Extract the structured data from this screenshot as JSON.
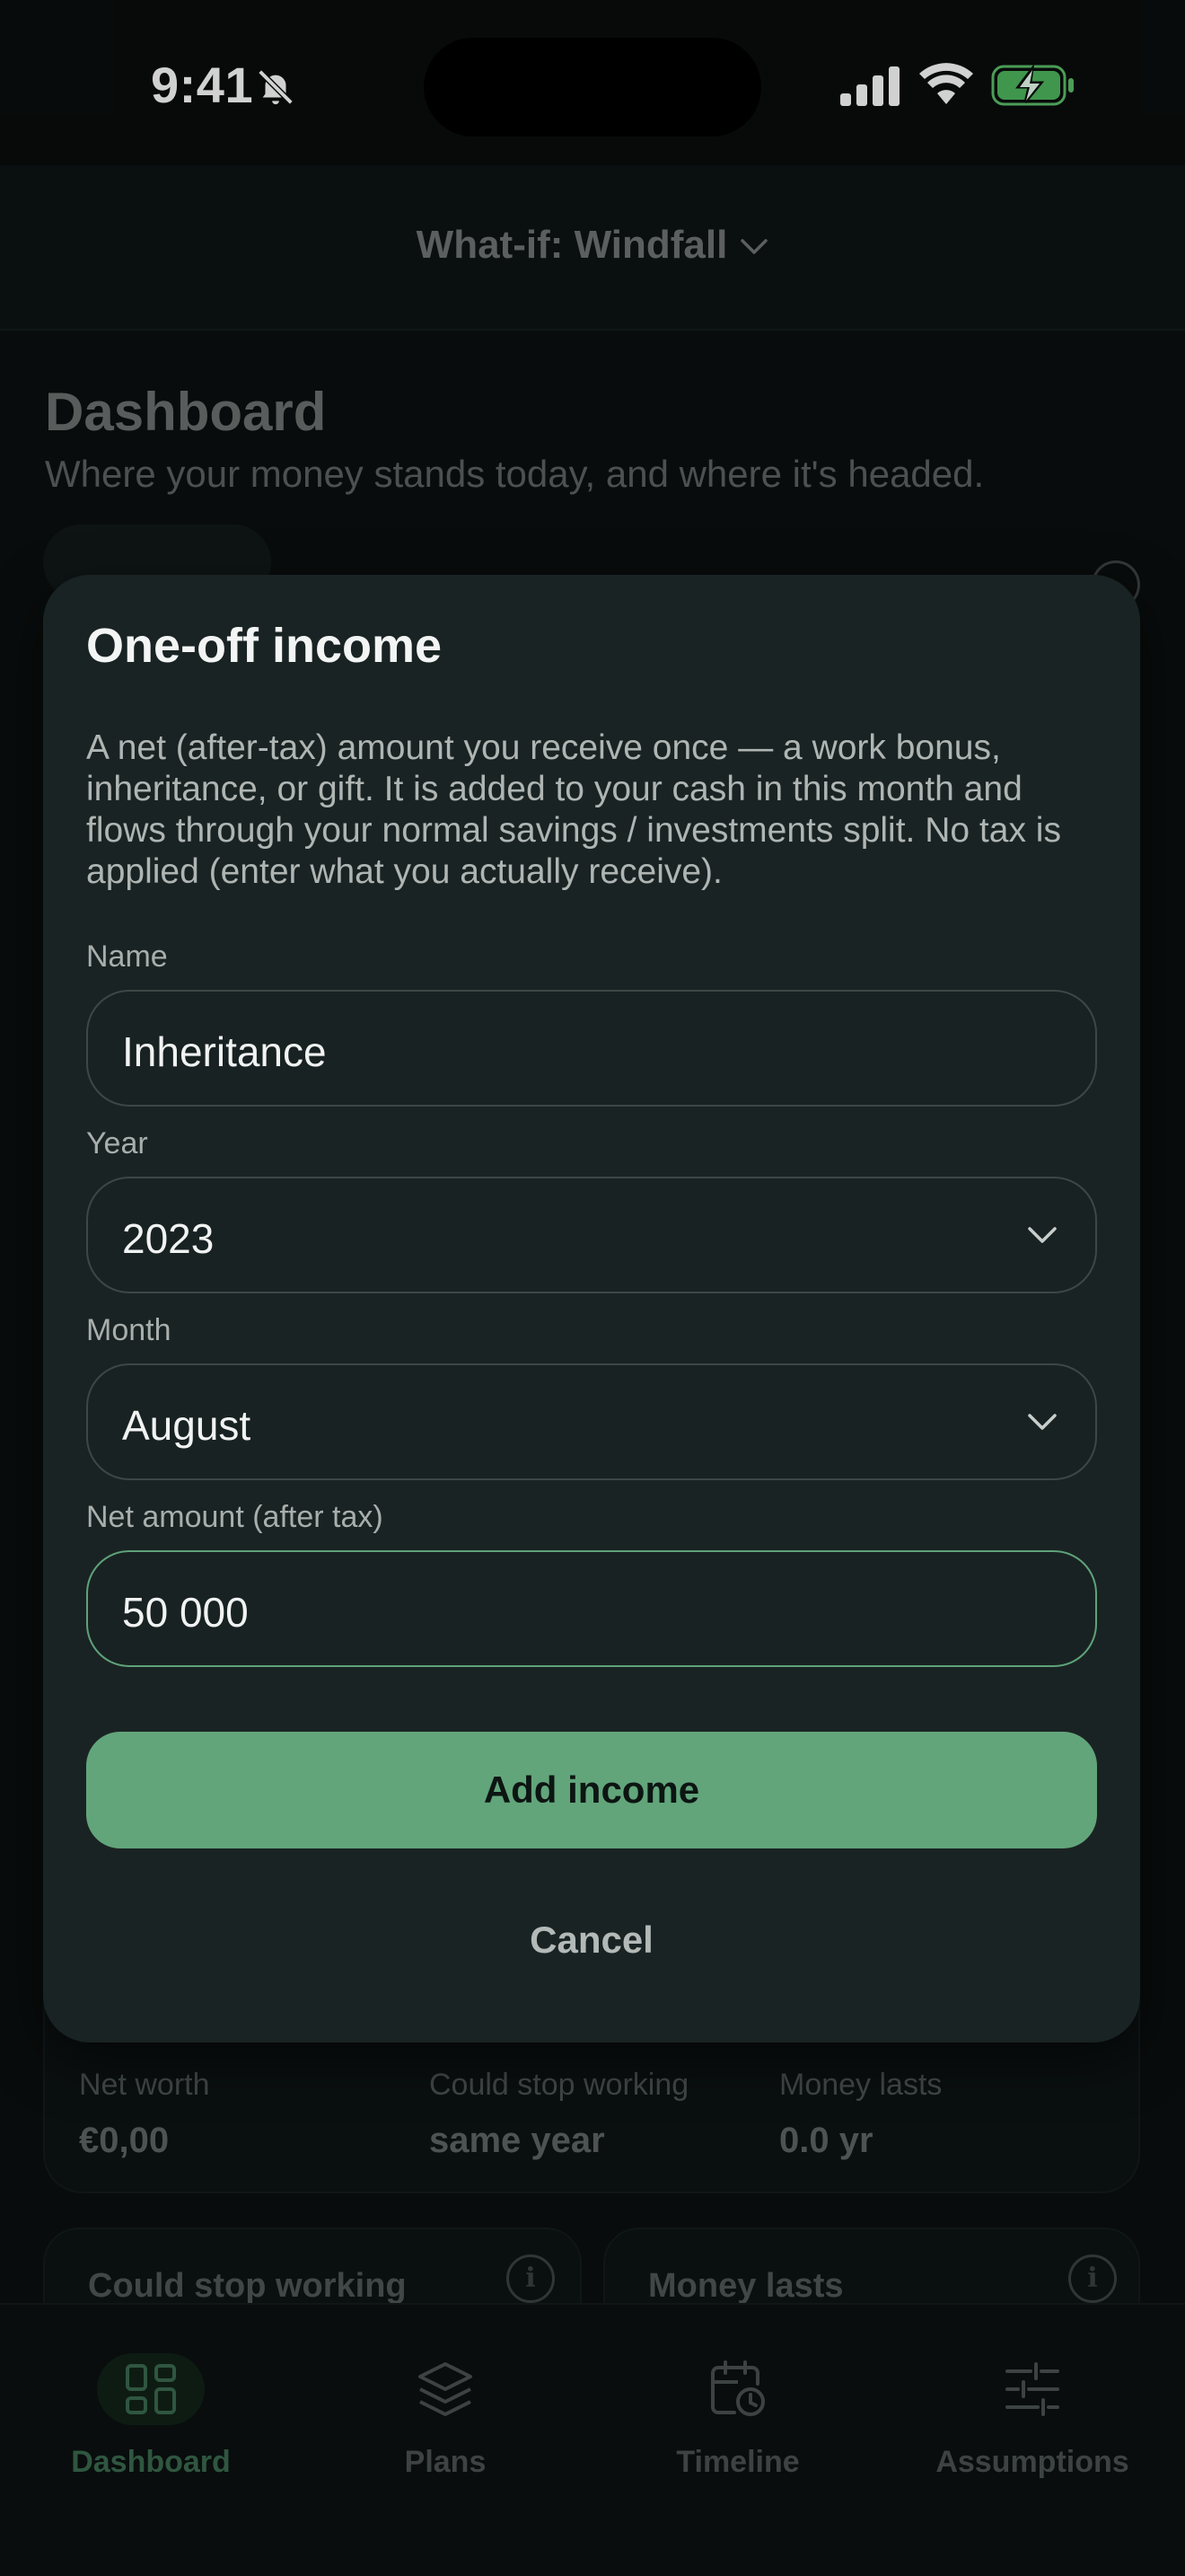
{
  "status": {
    "time": "9:41"
  },
  "header": {
    "scenario_label": "What-if: Windfall"
  },
  "dashboard": {
    "title": "Dashboard",
    "subtitle": "Where your money stands today, and where it's headed.",
    "stats": [
      {
        "label": "Net worth",
        "value": "€0,00"
      },
      {
        "label": "Could stop working",
        "value": "same year"
      },
      {
        "label": "Money lasts",
        "value": "0.0 yr"
      }
    ],
    "cards": [
      {
        "label": "Could stop working",
        "icon": "info-icon"
      },
      {
        "label": "Money lasts",
        "icon": "info-icon"
      }
    ]
  },
  "modal": {
    "title": "One-off income",
    "description": "A net (after-tax) amount you receive once — a work bonus, inheritance, or gift. It is added to your cash in this month and flows through your normal savings / investments split. No tax is applied (enter what you actually receive).",
    "name_label": "Name",
    "name_value": "Inheritance",
    "year_label": "Year",
    "year_value": "2023",
    "month_label": "Month",
    "month_value": "August",
    "amount_label": "Net amount (after tax)",
    "amount_value": "50 000",
    "submit_label": "Add income",
    "cancel_label": "Cancel"
  },
  "tabs": [
    {
      "label": "Dashboard",
      "icon": "grid-icon",
      "active": true
    },
    {
      "label": "Plans",
      "icon": "layers-icon",
      "active": false
    },
    {
      "label": "Timeline",
      "icon": "calendar-clock-icon",
      "active": false
    },
    {
      "label": "Assumptions",
      "icon": "sliders-icon",
      "active": false
    }
  ],
  "colors": {
    "accent": "#62a57b",
    "background": "#0b0f0f",
    "modal": "#1a2323"
  }
}
